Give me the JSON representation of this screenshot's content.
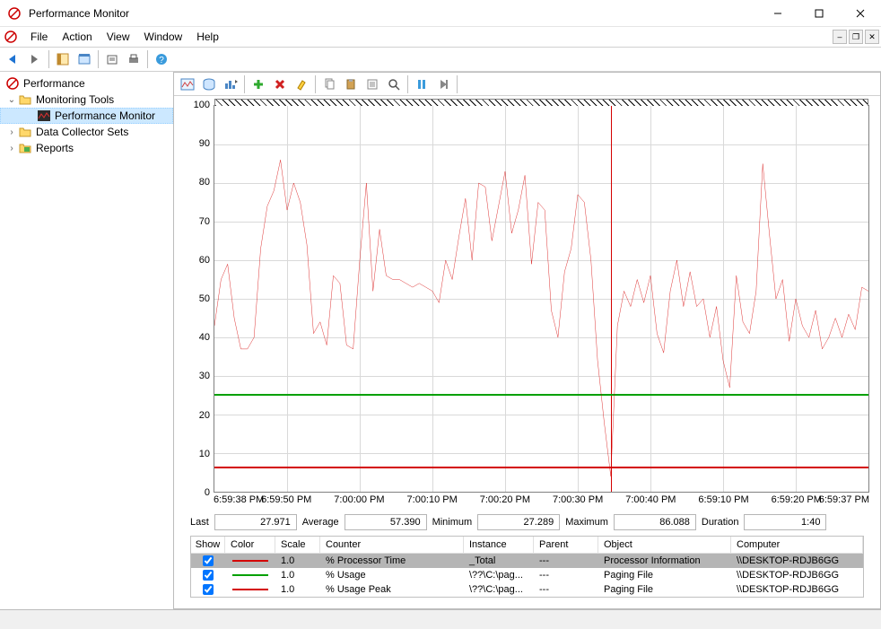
{
  "title": "Performance Monitor",
  "menu": {
    "file": "File",
    "action": "Action",
    "view": "View",
    "window": "Window",
    "help": "Help"
  },
  "tree": {
    "root": "Performance",
    "monitoring_tools": "Monitoring Tools",
    "performance_monitor": "Performance Monitor",
    "data_collector_sets": "Data Collector Sets",
    "reports": "Reports"
  },
  "stats": {
    "last_label": "Last",
    "last": "27.971",
    "avg_label": "Average",
    "avg": "57.390",
    "min_label": "Minimum",
    "min": "27.289",
    "max_label": "Maximum",
    "max": "86.088",
    "dur_label": "Duration",
    "dur": "1:40"
  },
  "xaxis": [
    "6:59:38 PM",
    "6:59:50 PM",
    "7:00:00 PM",
    "7:00:10 PM",
    "7:00:20 PM",
    "7:00:30 PM",
    "7:00:40 PM",
    "6:59:10 PM",
    "6:59:20 PM",
    "6:59:37 PM"
  ],
  "yaxis": [
    "100",
    "90",
    "80",
    "70",
    "60",
    "50",
    "40",
    "30",
    "20",
    "10",
    "0"
  ],
  "table": {
    "headers": {
      "show": "Show",
      "color": "Color",
      "scale": "Scale",
      "counter": "Counter",
      "instance": "Instance",
      "parent": "Parent",
      "object": "Object",
      "computer": "Computer"
    },
    "rows": [
      {
        "checked": true,
        "color": "#d40000",
        "scale": "1.0",
        "counter": "% Processor Time",
        "instance": "_Total",
        "parent": "---",
        "object": "Processor Information",
        "computer": "\\\\DESKTOP-RDJB6GG",
        "selected": true
      },
      {
        "checked": true,
        "color": "#00a000",
        "scale": "1.0",
        "counter": "% Usage",
        "instance": "\\??\\C:\\pag...",
        "parent": "---",
        "object": "Paging File",
        "computer": "\\\\DESKTOP-RDJB6GG",
        "selected": false
      },
      {
        "checked": true,
        "color": "#d40000",
        "scale": "1.0",
        "counter": "% Usage Peak",
        "instance": "\\??\\C:\\pag...",
        "parent": "---",
        "object": "Paging File",
        "computer": "\\\\DESKTOP-RDJB6GG",
        "selected": false
      }
    ]
  },
  "chart_data": {
    "type": "line",
    "title": "",
    "xlabel": "",
    "ylabel": "",
    "ylim": [
      0,
      100
    ],
    "x_ticks": [
      "6:59:38 PM",
      "6:59:50 PM",
      "7:00:00 PM",
      "7:00:10 PM",
      "7:00:20 PM",
      "7:00:30 PM",
      "7:00:40 PM",
      "6:59:10 PM",
      "6:59:20 PM",
      "6:59:37 PM"
    ],
    "cursor_position_index": 60,
    "series": [
      {
        "name": "% Processor Time",
        "color": "#d40000",
        "values": [
          43,
          55,
          59,
          45,
          37,
          37,
          40,
          63,
          74,
          78,
          86,
          73,
          80,
          75,
          64,
          41,
          44,
          38,
          56,
          54,
          38,
          37,
          60,
          80,
          52,
          68,
          56,
          55,
          55,
          54,
          53,
          54,
          53,
          52,
          49,
          60,
          55,
          66,
          76,
          60,
          80,
          79,
          65,
          74,
          83,
          67,
          73,
          82,
          59,
          75,
          73,
          47,
          40,
          57,
          63,
          77,
          75,
          60,
          34,
          18,
          4,
          43,
          52,
          48,
          55,
          49,
          56,
          41,
          36,
          52,
          60,
          48,
          57,
          48,
          50,
          40,
          48,
          34,
          27,
          56,
          44,
          41,
          52,
          85,
          67,
          50,
          55,
          39,
          50,
          43,
          40,
          47,
          37,
          40,
          45,
          40,
          46,
          42,
          53,
          52
        ]
      },
      {
        "name": "% Usage",
        "color": "#00a000",
        "flat_value": 25
      },
      {
        "name": "% Usage Peak",
        "color": "#d40000",
        "flat_value": 6
      }
    ]
  }
}
